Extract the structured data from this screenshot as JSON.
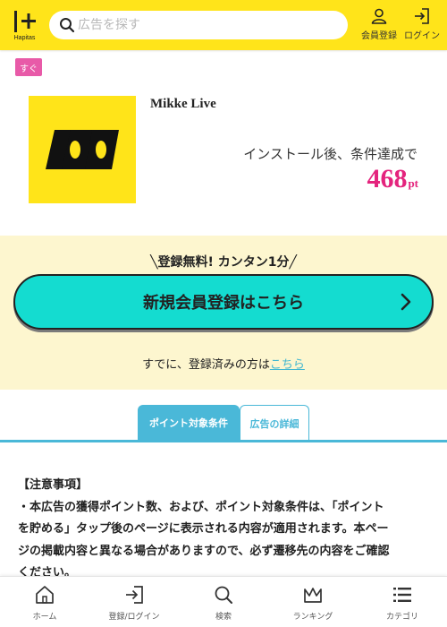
{
  "header": {
    "logo_text": "Hapitas",
    "search": {
      "placeholder": "広告を探す",
      "value": ""
    },
    "register_label": "会員登録",
    "login_label": "ログイン"
  },
  "ad": {
    "badge": "すぐ",
    "app_name": "Mikke Live",
    "condition": "インストール後、条件達成で",
    "points": "468",
    "points_unit": "pt"
  },
  "registration": {
    "promo": "╲登録無料! カンタン1分╱",
    "cta_label": "新規会員登録はこちら",
    "already_text": "すでに、登録済みの方は",
    "already_link": "こちら"
  },
  "tabs": [
    {
      "label": "ポイント対象条件",
      "active": true
    },
    {
      "label": "広告の詳細",
      "active": false
    }
  ],
  "notes": {
    "heading": "【注意事項】",
    "line1": "・本広告の獲得ポイント数、および、ポイント対象条件は、「ポイント",
    "line2": "を貯める」タップ後のページに表示される内容が適用されます。本ペー",
    "line3": "ジの掲載内容と異なる場合がありますので、必ず遷移先の内容をご確認",
    "line4": "ください。"
  },
  "bottom_nav": [
    {
      "label": "ホーム",
      "icon": "home-icon"
    },
    {
      "label": "登録/ログイン",
      "icon": "login-icon"
    },
    {
      "label": "検索",
      "icon": "search-icon"
    },
    {
      "label": "ランキング",
      "icon": "crown-icon"
    },
    {
      "label": "カテゴリ",
      "icon": "list-icon"
    }
  ],
  "colors": {
    "header_bg": "#ffe41a",
    "badge": "#e85aa8",
    "points": "#e4237d",
    "cta": "#14dcd0",
    "tab_accent": "#4ab8d8",
    "reg_bg": "#fdf6cf"
  }
}
